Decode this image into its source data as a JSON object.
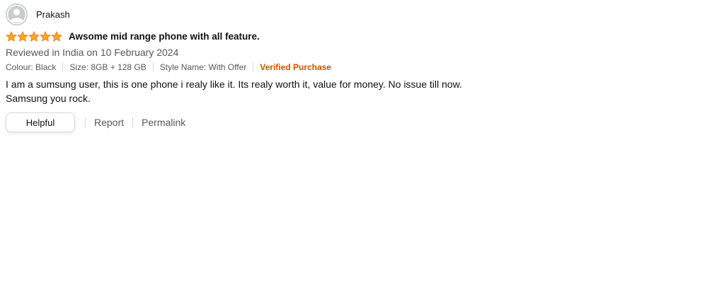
{
  "profile": {
    "name": "Prakash",
    "avatar_icon": "default-user-avatar-icon"
  },
  "review": {
    "rating": 5,
    "rating_max": 5,
    "star_color": "#ffa41c",
    "title": "Awsome mid range phone with all feature.",
    "date": "Reviewed in India on 10 February 2024",
    "format": {
      "colour": "Colour: Black",
      "size": "Size: 8GB + 128 GB",
      "style": "Style Name: With Offer"
    },
    "verified_label": "Verified Purchase",
    "verified_color": "#c45500",
    "body_line1": "I am a sumsung user, this is one phone i realy like it. Its realy worth it, value for money. No issue till now.",
    "body_line2": "Samsung you rock."
  },
  "actions": {
    "helpful_label": "Helpful",
    "report_label": "Report",
    "permalink_label": "Permalink"
  }
}
